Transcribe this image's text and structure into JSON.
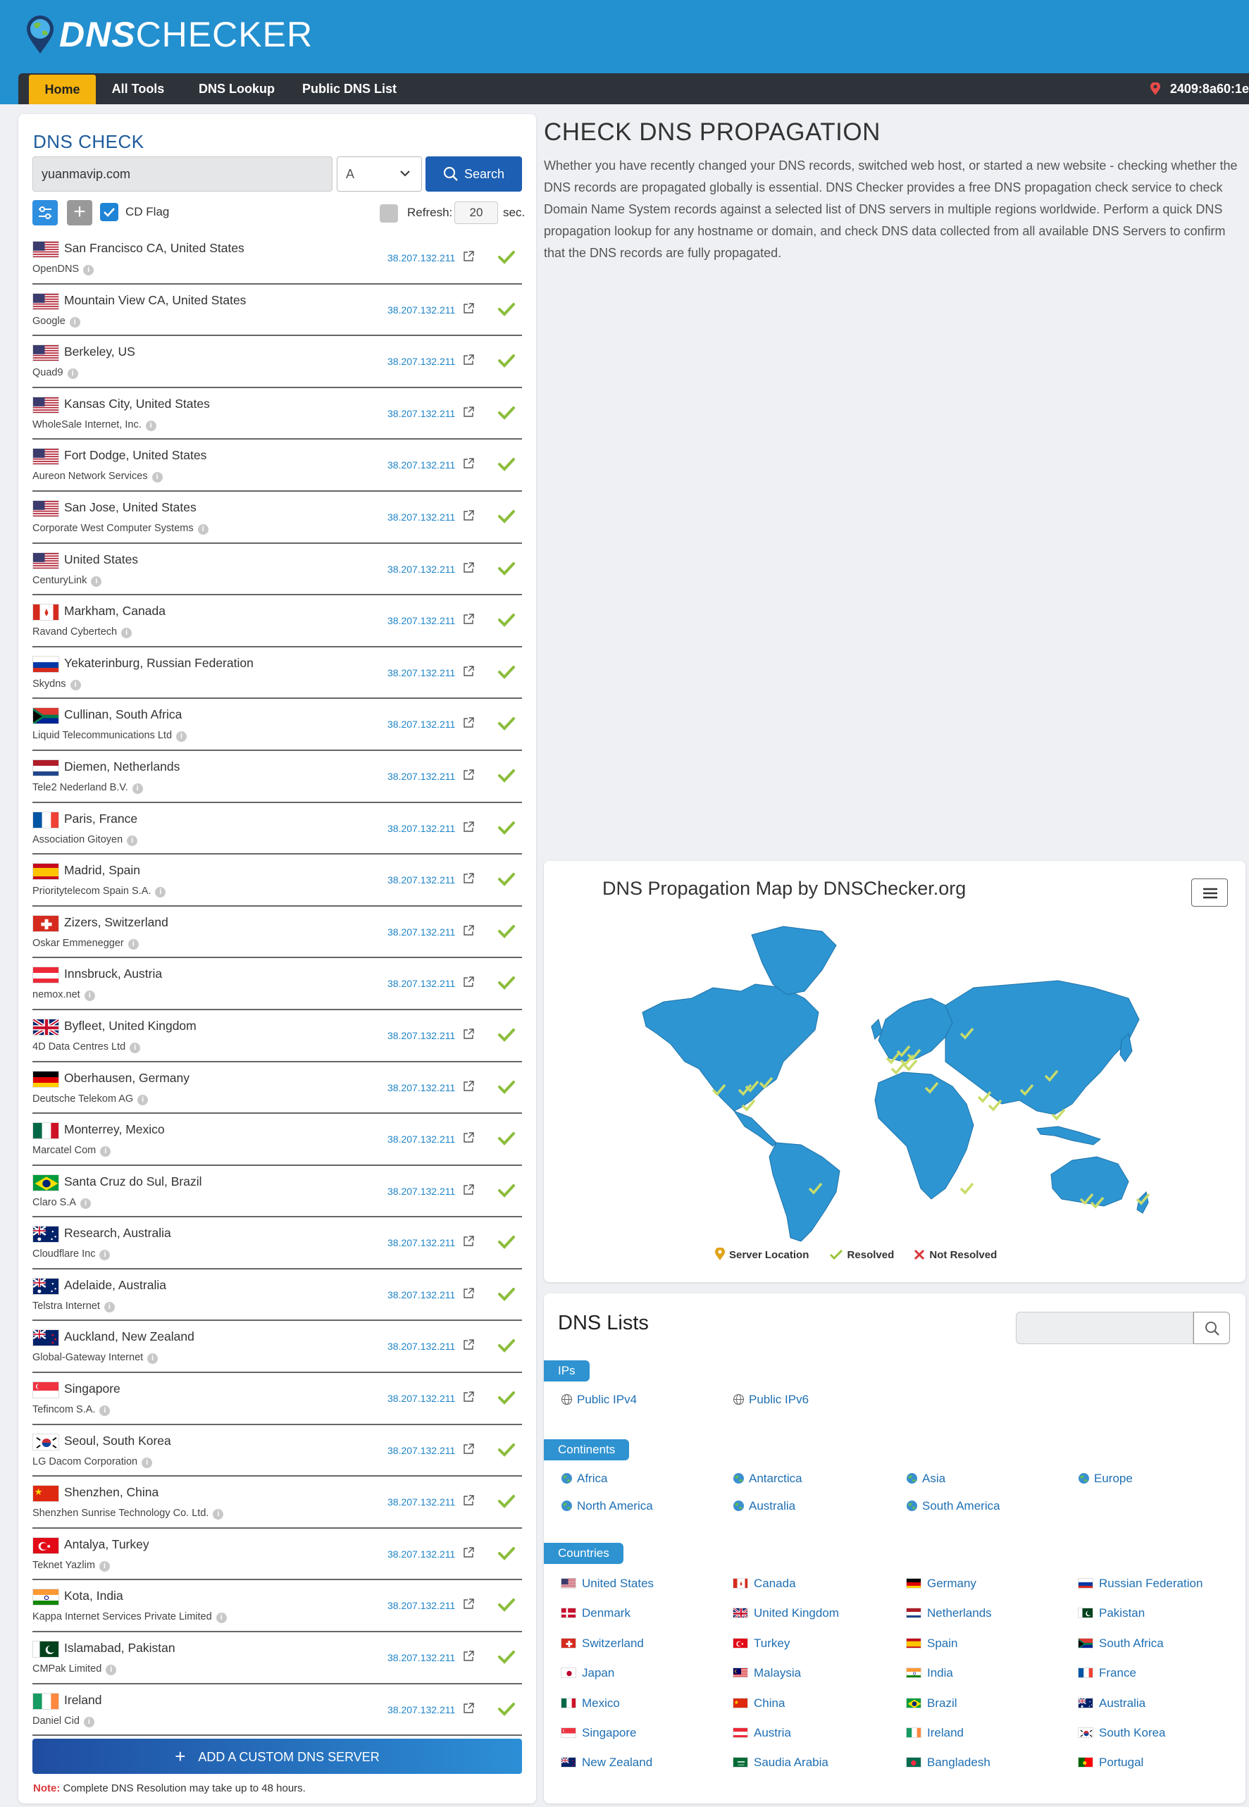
{
  "brand": {
    "dns": "DNS",
    "checker": "CHECKER"
  },
  "nav": {
    "items": [
      "Home",
      "All Tools",
      "DNS Lookup",
      "Public DNS List"
    ],
    "ip": "2409:8a60:1e"
  },
  "check": {
    "title": "DNS CHECK",
    "domain": "yuanmavip.com",
    "type": "A",
    "search_label": "Search",
    "cd_flag_label": "CD Flag",
    "refresh_label": "Refresh:",
    "refresh_value": "20",
    "refresh_unit": "sec."
  },
  "servers": [
    {
      "flag": "us",
      "location": "San Francisco CA, United States",
      "provider": "OpenDNS",
      "ip": "38.207.132.211"
    },
    {
      "flag": "us",
      "location": "Mountain View CA, United States",
      "provider": "Google",
      "ip": "38.207.132.211"
    },
    {
      "flag": "us",
      "location": "Berkeley, US",
      "provider": "Quad9",
      "ip": "38.207.132.211"
    },
    {
      "flag": "us",
      "location": "Kansas City, United States",
      "provider": "WholeSale Internet, Inc.",
      "ip": "38.207.132.211"
    },
    {
      "flag": "us",
      "location": "Fort Dodge, United States",
      "provider": "Aureon Network Services",
      "ip": "38.207.132.211"
    },
    {
      "flag": "us",
      "location": "San Jose, United States",
      "provider": "Corporate West Computer Systems",
      "ip": "38.207.132.211"
    },
    {
      "flag": "us",
      "location": "United States",
      "provider": "CenturyLink",
      "ip": "38.207.132.211"
    },
    {
      "flag": "ca",
      "location": "Markham, Canada",
      "provider": "Ravand Cybertech",
      "ip": "38.207.132.211"
    },
    {
      "flag": "ru",
      "location": "Yekaterinburg, Russian Federation",
      "provider": "Skydns",
      "ip": "38.207.132.211"
    },
    {
      "flag": "za",
      "location": "Cullinan, South Africa",
      "provider": "Liquid Telecommunications Ltd",
      "ip": "38.207.132.211"
    },
    {
      "flag": "nl",
      "location": "Diemen, Netherlands",
      "provider": "Tele2 Nederland B.V.",
      "ip": "38.207.132.211"
    },
    {
      "flag": "fr",
      "location": "Paris, France",
      "provider": "Association Gitoyen",
      "ip": "38.207.132.211"
    },
    {
      "flag": "es",
      "location": "Madrid, Spain",
      "provider": "Prioritytelecom Spain S.A.",
      "ip": "38.207.132.211"
    },
    {
      "flag": "ch",
      "location": "Zizers, Switzerland",
      "provider": "Oskar Emmenegger",
      "ip": "38.207.132.211"
    },
    {
      "flag": "at",
      "location": "Innsbruck, Austria",
      "provider": "nemox.net",
      "ip": "38.207.132.211"
    },
    {
      "flag": "gb",
      "location": "Byfleet, United Kingdom",
      "provider": "4D Data Centres Ltd",
      "ip": "38.207.132.211"
    },
    {
      "flag": "de",
      "location": "Oberhausen, Germany",
      "provider": "Deutsche Telekom AG",
      "ip": "38.207.132.211"
    },
    {
      "flag": "mx",
      "location": "Monterrey, Mexico",
      "provider": "Marcatel Com",
      "ip": "38.207.132.211"
    },
    {
      "flag": "br",
      "location": "Santa Cruz do Sul, Brazil",
      "provider": "Claro S.A",
      "ip": "38.207.132.211"
    },
    {
      "flag": "au",
      "location": "Research, Australia",
      "provider": "Cloudflare Inc",
      "ip": "38.207.132.211"
    },
    {
      "flag": "au",
      "location": "Adelaide, Australia",
      "provider": "Telstra Internet",
      "ip": "38.207.132.211"
    },
    {
      "flag": "nz",
      "location": "Auckland, New Zealand",
      "provider": "Global-Gateway Internet",
      "ip": "38.207.132.211"
    },
    {
      "flag": "sg",
      "location": "Singapore",
      "provider": "Tefincom S.A.",
      "ip": "38.207.132.211"
    },
    {
      "flag": "kr",
      "location": "Seoul, South Korea",
      "provider": "LG Dacom Corporation",
      "ip": "38.207.132.211"
    },
    {
      "flag": "cn",
      "location": "Shenzhen, China",
      "provider": "Shenzhen Sunrise Technology Co. Ltd.",
      "ip": "38.207.132.211"
    },
    {
      "flag": "tr",
      "location": "Antalya, Turkey",
      "provider": "Teknet Yazlim",
      "ip": "38.207.132.211"
    },
    {
      "flag": "in",
      "location": "Kota, India",
      "provider": "Kappa Internet Services Private Limited",
      "ip": "38.207.132.211"
    },
    {
      "flag": "pk",
      "location": "Islamabad, Pakistan",
      "provider": "CMPak Limited",
      "ip": "38.207.132.211"
    },
    {
      "flag": "ie",
      "location": "Ireland",
      "provider": "Daniel Cid",
      "ip": "38.207.132.211"
    }
  ],
  "add_server_label": "ADD A CUSTOM DNS SERVER",
  "note": {
    "label": "Note:",
    "text": "Complete DNS Resolution may take up to 48 hours."
  },
  "propagation": {
    "title": "CHECK DNS PROPAGATION",
    "description": "Whether you have recently changed your DNS records, switched web host, or started a new website - checking whether the DNS records are propagated globally is essential. DNS Checker provides a free DNS propagation check service to check Domain Name System records against a selected list of DNS servers in multiple regions worldwide. Perform a quick DNS propagation lookup for any hostname or domain, and check DNS data collected from all available DNS Servers to confirm that the DNS records are fully propagated."
  },
  "map": {
    "title": "DNS Propagation Map by DNSChecker.org",
    "legend": [
      "Server Location",
      "Resolved",
      "Not Resolved"
    ],
    "land_color": "#2e95d3",
    "resolved_color": "#9bc43a"
  },
  "lists": {
    "title": "DNS Lists",
    "sections": {
      "ips": "IPs",
      "continents": "Continents",
      "countries": "Countries"
    },
    "ips": [
      "Public IPv4",
      "Public IPv6"
    ],
    "continents": [
      "Africa",
      "Antarctica",
      "Asia",
      "Europe",
      "North America",
      "Australia",
      "South America"
    ],
    "countries": [
      {
        "flag": "us",
        "name": "United States"
      },
      {
        "flag": "ca",
        "name": "Canada"
      },
      {
        "flag": "de",
        "name": "Germany"
      },
      {
        "flag": "ru",
        "name": "Russian Federation"
      },
      {
        "flag": "dk",
        "name": "Denmark"
      },
      {
        "flag": "gb",
        "name": "United Kingdom"
      },
      {
        "flag": "nl",
        "name": "Netherlands"
      },
      {
        "flag": "pk",
        "name": "Pakistan"
      },
      {
        "flag": "ch",
        "name": "Switzerland"
      },
      {
        "flag": "tr",
        "name": "Turkey"
      },
      {
        "flag": "es",
        "name": "Spain"
      },
      {
        "flag": "za",
        "name": "South Africa"
      },
      {
        "flag": "jp",
        "name": "Japan"
      },
      {
        "flag": "my",
        "name": "Malaysia"
      },
      {
        "flag": "in",
        "name": "India"
      },
      {
        "flag": "fr",
        "name": "France"
      },
      {
        "flag": "mx",
        "name": "Mexico"
      },
      {
        "flag": "cn",
        "name": "China"
      },
      {
        "flag": "br",
        "name": "Brazil"
      },
      {
        "flag": "au",
        "name": "Australia"
      },
      {
        "flag": "sg",
        "name": "Singapore"
      },
      {
        "flag": "at",
        "name": "Austria"
      },
      {
        "flag": "ie",
        "name": "Ireland"
      },
      {
        "flag": "kr",
        "name": "South Korea"
      },
      {
        "flag": "nz",
        "name": "New Zealand"
      },
      {
        "flag": "sa",
        "name": "Saudia Arabia"
      },
      {
        "flag": "bd",
        "name": "Bangladesh"
      },
      {
        "flag": "pt",
        "name": "Portugal"
      }
    ]
  }
}
